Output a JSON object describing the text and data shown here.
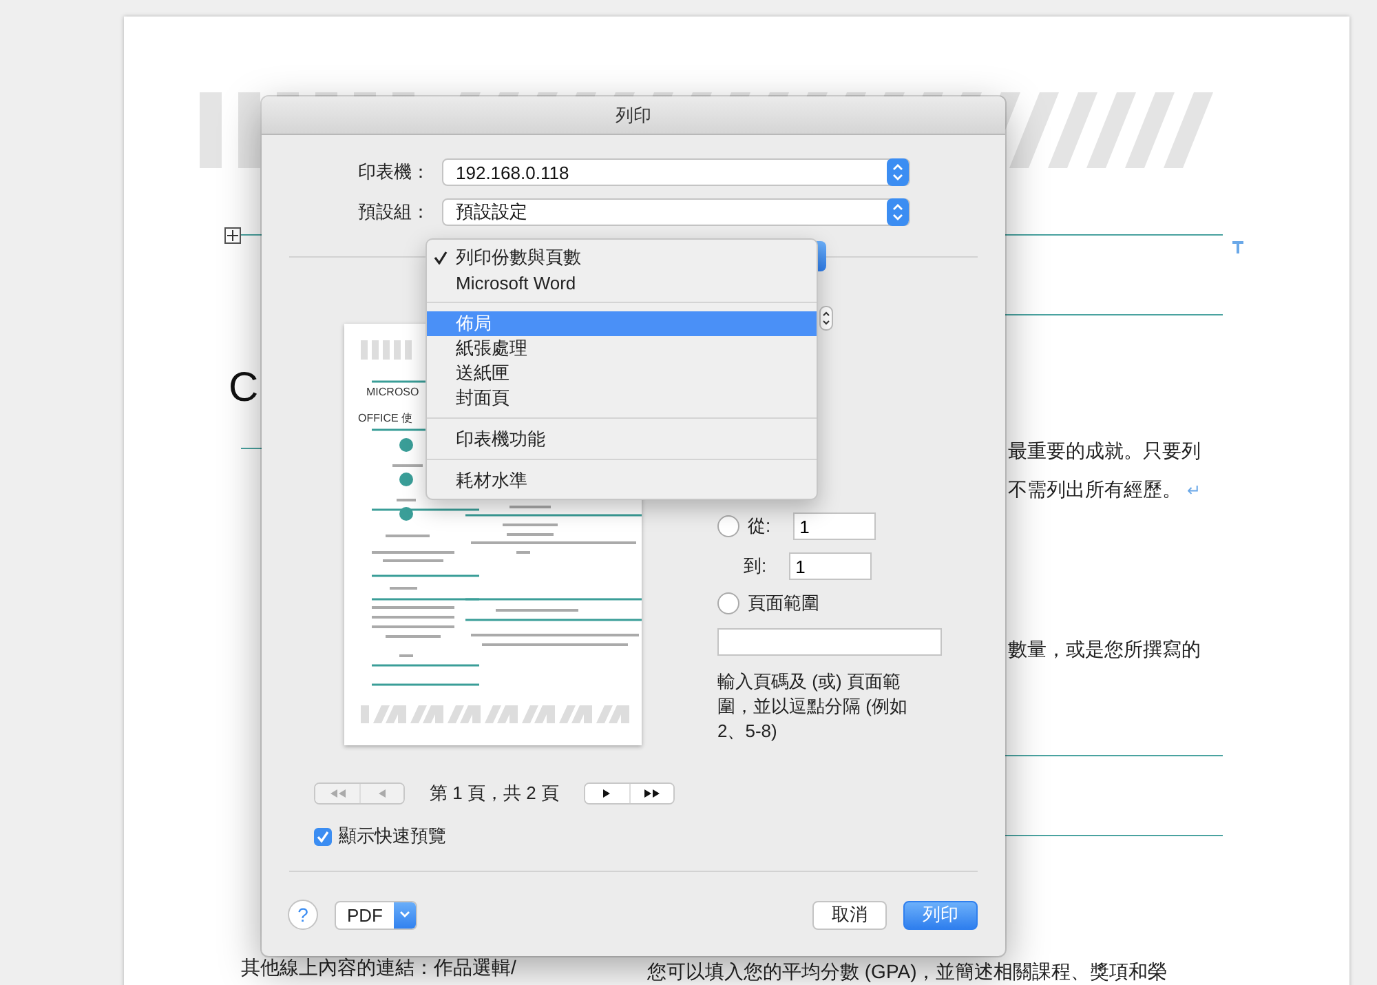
{
  "document": {
    "heading_letter": "C",
    "right_lines": [
      {
        "text": "最重要的成就。只要列"
      },
      {
        "text": "不需列出所有經歷。",
        "mark": "↵"
      },
      {
        "text": "數量，或是您所撰寫的"
      }
    ],
    "bottom_left": "其他線上內容的連結：作品選輯/",
    "bottom_right": "您可以填入您的平均分數 (GPA)，並簡述相關課程、獎項和榮"
  },
  "dialog": {
    "title": "列印",
    "printer": {
      "label": "印表機：",
      "value": "192.168.0.118"
    },
    "preset": {
      "label": "預設組：",
      "value": "預設設定"
    },
    "menu": {
      "groups": [
        [
          {
            "label": "列印份數與頁數",
            "checked": true,
            "selected": false
          },
          {
            "label": "Microsoft Word",
            "checked": false,
            "selected": false
          }
        ],
        [
          {
            "label": "佈局",
            "checked": false,
            "selected": true
          },
          {
            "label": "紙張處理",
            "checked": false,
            "selected": false
          },
          {
            "label": "送紙匣",
            "checked": false,
            "selected": false
          },
          {
            "label": "封面頁",
            "checked": false,
            "selected": false
          }
        ],
        [
          {
            "label": "印表機功能",
            "checked": false,
            "selected": false
          }
        ],
        [
          {
            "label": "耗材水準",
            "checked": false,
            "selected": false
          }
        ]
      ]
    },
    "preview": {
      "lines": [
        "MICROSO",
        "OFFICE 使"
      ]
    },
    "range": {
      "from": {
        "label": "從:",
        "value": "1",
        "selected": false
      },
      "to": {
        "label": "到:",
        "value": "1"
      },
      "page_range": {
        "label": "頁面範圍",
        "selected": false
      },
      "hint": "輸入頁碼及 (或) 頁面範圍，並以逗點分隔 (例如 2、5-8)"
    },
    "pager": {
      "label": "第 1 頁，共 2 頁",
      "back_disabled": true,
      "forward_disabled": false
    },
    "quick_preview": {
      "label": "顯示快速預覽",
      "checked": true
    },
    "help": "?",
    "pdf": "PDF",
    "cancel": "取消",
    "print": "列印"
  }
}
